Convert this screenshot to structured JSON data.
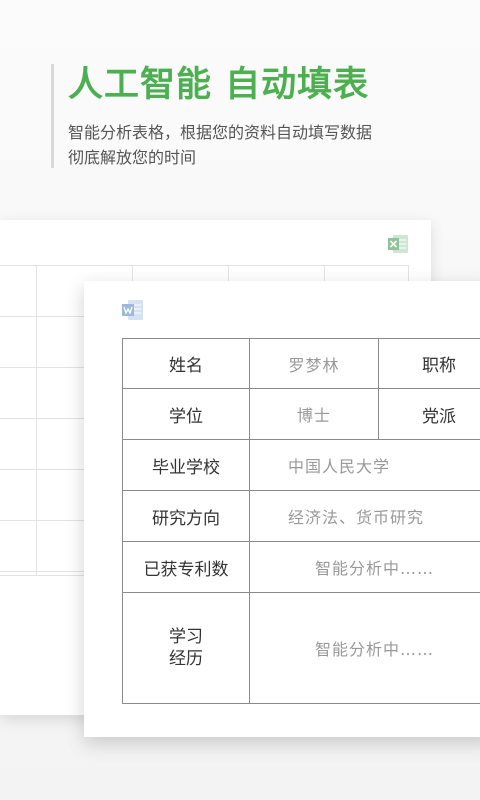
{
  "hero": {
    "title": "人工智能 自动填表",
    "subtitle_line1": "智能分析表格，根据您的资料自动填写数据",
    "subtitle_line2": "彻底解放您的时间"
  },
  "form": {
    "name_label": "姓名",
    "name_value": "罗梦林",
    "title_label": "职称",
    "degree_label": "学位",
    "degree_value": "博士",
    "party_label": "党派",
    "school_label": "毕业学校",
    "school_value": "中国人民大学",
    "research_label": "研究方向",
    "research_value": "经济法、货币研究",
    "patents_label": "已获专利数",
    "patents_value": "智能分析中……",
    "study_label_line1": "学习",
    "study_label_line2": "经历",
    "study_value": "智能分析中……"
  },
  "colors": {
    "accent": "#4caf50",
    "excel": "#5ea36c",
    "word": "#4a78c2"
  },
  "icons": {
    "excel": "excel-file-icon",
    "word": "word-file-icon"
  }
}
